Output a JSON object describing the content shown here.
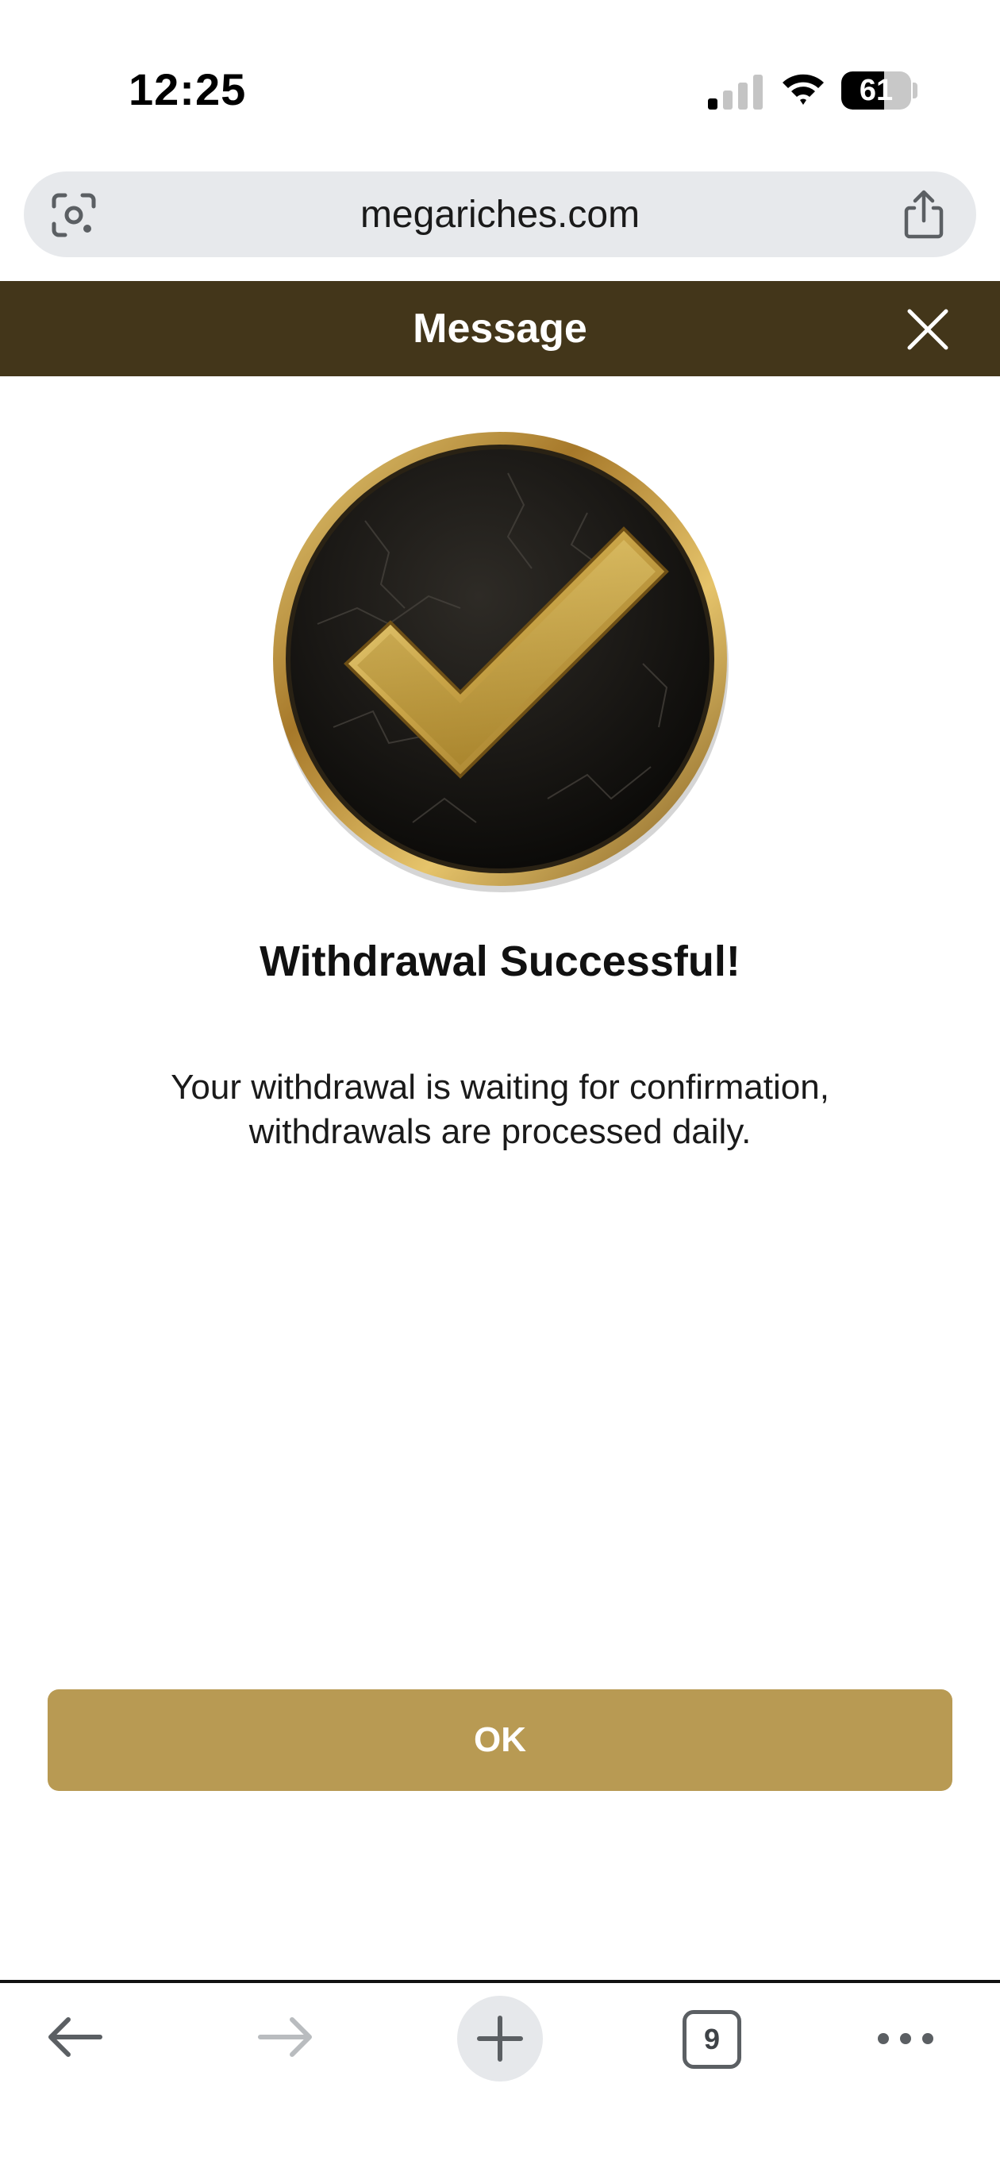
{
  "status_bar": {
    "time": "12:25",
    "battery_level": "61",
    "battery_fraction": 0.61
  },
  "browser": {
    "url": "megariches.com",
    "tab_count": "9"
  },
  "modal": {
    "title": "Message",
    "heading": "Withdrawal Successful!",
    "message": "Your withdrawal is waiting for confirmation, withdrawals are processed daily.",
    "ok_label": "OK"
  },
  "icons": {
    "badge": "gold-checkmark-icon",
    "close": "close-icon",
    "lens": "lens-icon",
    "share": "share-icon",
    "back": "back-arrow-icon",
    "forward": "forward-arrow-icon",
    "new_tab": "plus-icon",
    "more": "more-dots-icon"
  },
  "colors": {
    "header_bg": "#43361a",
    "accent_gold": "#b89a53",
    "url_bar_bg": "#e7e9ec"
  }
}
